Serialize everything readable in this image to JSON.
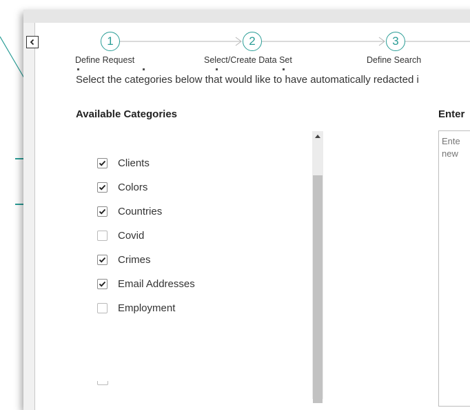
{
  "stepper": {
    "steps": [
      {
        "number": "1",
        "label": "Define Request"
      },
      {
        "number": "2",
        "label": "Select/Create Data Set"
      },
      {
        "number": "3",
        "label": "Define Search"
      }
    ]
  },
  "main": {
    "instruction": "Select the categories below that would like to have automatically redacted i",
    "available_title": "Available Categories",
    "enter_title": "Enter",
    "textarea_placeholder": "Ente new",
    "categories": [
      {
        "label": "Clients",
        "checked": true
      },
      {
        "label": "Colors",
        "checked": true
      },
      {
        "label": "Countries",
        "checked": true
      },
      {
        "label": "Covid",
        "checked": false
      },
      {
        "label": "Crimes",
        "checked": true
      },
      {
        "label": "Email Addresses",
        "checked": true
      },
      {
        "label": "Employment",
        "checked": false
      }
    ]
  },
  "colors": {
    "accent": "#2a9d96",
    "text": "#333333"
  },
  "icons": {
    "collapse": "chevron-left-icon",
    "check": "check-icon",
    "scroll_up": "triangle-up-icon"
  }
}
